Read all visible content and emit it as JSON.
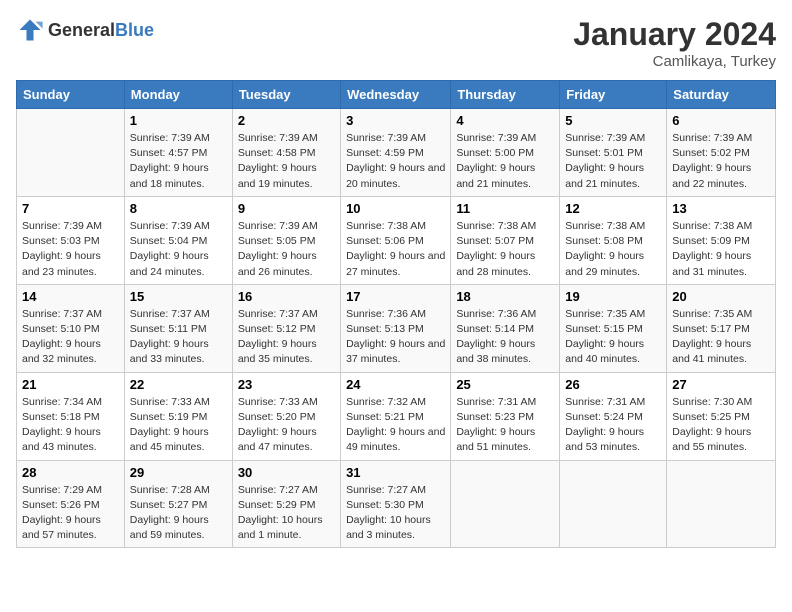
{
  "header": {
    "logo_general": "General",
    "logo_blue": "Blue",
    "title": "January 2024",
    "subtitle": "Camlikaya, Turkey"
  },
  "days_of_week": [
    "Sunday",
    "Monday",
    "Tuesday",
    "Wednesday",
    "Thursday",
    "Friday",
    "Saturday"
  ],
  "weeks": [
    [
      {
        "day": "",
        "sunrise": "",
        "sunset": "",
        "daylight": ""
      },
      {
        "day": "1",
        "sunrise": "Sunrise: 7:39 AM",
        "sunset": "Sunset: 4:57 PM",
        "daylight": "Daylight: 9 hours and 18 minutes."
      },
      {
        "day": "2",
        "sunrise": "Sunrise: 7:39 AM",
        "sunset": "Sunset: 4:58 PM",
        "daylight": "Daylight: 9 hours and 19 minutes."
      },
      {
        "day": "3",
        "sunrise": "Sunrise: 7:39 AM",
        "sunset": "Sunset: 4:59 PM",
        "daylight": "Daylight: 9 hours and 20 minutes."
      },
      {
        "day": "4",
        "sunrise": "Sunrise: 7:39 AM",
        "sunset": "Sunset: 5:00 PM",
        "daylight": "Daylight: 9 hours and 21 minutes."
      },
      {
        "day": "5",
        "sunrise": "Sunrise: 7:39 AM",
        "sunset": "Sunset: 5:01 PM",
        "daylight": "Daylight: 9 hours and 21 minutes."
      },
      {
        "day": "6",
        "sunrise": "Sunrise: 7:39 AM",
        "sunset": "Sunset: 5:02 PM",
        "daylight": "Daylight: 9 hours and 22 minutes."
      }
    ],
    [
      {
        "day": "7",
        "sunrise": "Sunrise: 7:39 AM",
        "sunset": "Sunset: 5:03 PM",
        "daylight": "Daylight: 9 hours and 23 minutes."
      },
      {
        "day": "8",
        "sunrise": "Sunrise: 7:39 AM",
        "sunset": "Sunset: 5:04 PM",
        "daylight": "Daylight: 9 hours and 24 minutes."
      },
      {
        "day": "9",
        "sunrise": "Sunrise: 7:39 AM",
        "sunset": "Sunset: 5:05 PM",
        "daylight": "Daylight: 9 hours and 26 minutes."
      },
      {
        "day": "10",
        "sunrise": "Sunrise: 7:38 AM",
        "sunset": "Sunset: 5:06 PM",
        "daylight": "Daylight: 9 hours and 27 minutes."
      },
      {
        "day": "11",
        "sunrise": "Sunrise: 7:38 AM",
        "sunset": "Sunset: 5:07 PM",
        "daylight": "Daylight: 9 hours and 28 minutes."
      },
      {
        "day": "12",
        "sunrise": "Sunrise: 7:38 AM",
        "sunset": "Sunset: 5:08 PM",
        "daylight": "Daylight: 9 hours and 29 minutes."
      },
      {
        "day": "13",
        "sunrise": "Sunrise: 7:38 AM",
        "sunset": "Sunset: 5:09 PM",
        "daylight": "Daylight: 9 hours and 31 minutes."
      }
    ],
    [
      {
        "day": "14",
        "sunrise": "Sunrise: 7:37 AM",
        "sunset": "Sunset: 5:10 PM",
        "daylight": "Daylight: 9 hours and 32 minutes."
      },
      {
        "day": "15",
        "sunrise": "Sunrise: 7:37 AM",
        "sunset": "Sunset: 5:11 PM",
        "daylight": "Daylight: 9 hours and 33 minutes."
      },
      {
        "day": "16",
        "sunrise": "Sunrise: 7:37 AM",
        "sunset": "Sunset: 5:12 PM",
        "daylight": "Daylight: 9 hours and 35 minutes."
      },
      {
        "day": "17",
        "sunrise": "Sunrise: 7:36 AM",
        "sunset": "Sunset: 5:13 PM",
        "daylight": "Daylight: 9 hours and 37 minutes."
      },
      {
        "day": "18",
        "sunrise": "Sunrise: 7:36 AM",
        "sunset": "Sunset: 5:14 PM",
        "daylight": "Daylight: 9 hours and 38 minutes."
      },
      {
        "day": "19",
        "sunrise": "Sunrise: 7:35 AM",
        "sunset": "Sunset: 5:15 PM",
        "daylight": "Daylight: 9 hours and 40 minutes."
      },
      {
        "day": "20",
        "sunrise": "Sunrise: 7:35 AM",
        "sunset": "Sunset: 5:17 PM",
        "daylight": "Daylight: 9 hours and 41 minutes."
      }
    ],
    [
      {
        "day": "21",
        "sunrise": "Sunrise: 7:34 AM",
        "sunset": "Sunset: 5:18 PM",
        "daylight": "Daylight: 9 hours and 43 minutes."
      },
      {
        "day": "22",
        "sunrise": "Sunrise: 7:33 AM",
        "sunset": "Sunset: 5:19 PM",
        "daylight": "Daylight: 9 hours and 45 minutes."
      },
      {
        "day": "23",
        "sunrise": "Sunrise: 7:33 AM",
        "sunset": "Sunset: 5:20 PM",
        "daylight": "Daylight: 9 hours and 47 minutes."
      },
      {
        "day": "24",
        "sunrise": "Sunrise: 7:32 AM",
        "sunset": "Sunset: 5:21 PM",
        "daylight": "Daylight: 9 hours and 49 minutes."
      },
      {
        "day": "25",
        "sunrise": "Sunrise: 7:31 AM",
        "sunset": "Sunset: 5:23 PM",
        "daylight": "Daylight: 9 hours and 51 minutes."
      },
      {
        "day": "26",
        "sunrise": "Sunrise: 7:31 AM",
        "sunset": "Sunset: 5:24 PM",
        "daylight": "Daylight: 9 hours and 53 minutes."
      },
      {
        "day": "27",
        "sunrise": "Sunrise: 7:30 AM",
        "sunset": "Sunset: 5:25 PM",
        "daylight": "Daylight: 9 hours and 55 minutes."
      }
    ],
    [
      {
        "day": "28",
        "sunrise": "Sunrise: 7:29 AM",
        "sunset": "Sunset: 5:26 PM",
        "daylight": "Daylight: 9 hours and 57 minutes."
      },
      {
        "day": "29",
        "sunrise": "Sunrise: 7:28 AM",
        "sunset": "Sunset: 5:27 PM",
        "daylight": "Daylight: 9 hours and 59 minutes."
      },
      {
        "day": "30",
        "sunrise": "Sunrise: 7:27 AM",
        "sunset": "Sunset: 5:29 PM",
        "daylight": "Daylight: 10 hours and 1 minute."
      },
      {
        "day": "31",
        "sunrise": "Sunrise: 7:27 AM",
        "sunset": "Sunset: 5:30 PM",
        "daylight": "Daylight: 10 hours and 3 minutes."
      },
      {
        "day": "",
        "sunrise": "",
        "sunset": "",
        "daylight": ""
      },
      {
        "day": "",
        "sunrise": "",
        "sunset": "",
        "daylight": ""
      },
      {
        "day": "",
        "sunrise": "",
        "sunset": "",
        "daylight": ""
      }
    ]
  ]
}
